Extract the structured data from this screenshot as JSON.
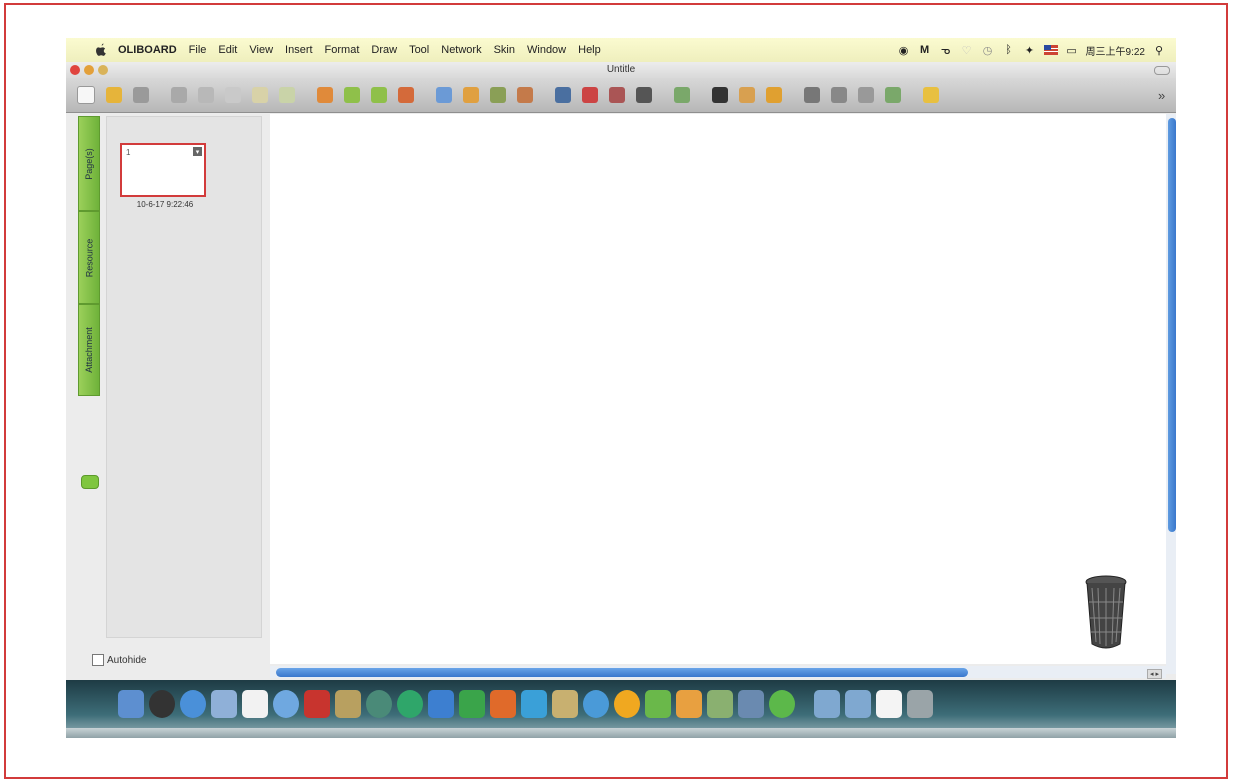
{
  "menubar": {
    "brand": "OLIBOARD",
    "items": [
      "File",
      "Edit",
      "View",
      "Insert",
      "Format",
      "Draw",
      "Tool",
      "Network",
      "Skin",
      "Window",
      "Help"
    ],
    "clock": "周三上午9:22"
  },
  "window": {
    "title": "Untitle"
  },
  "sidebar": {
    "tabs": [
      "Page(s)",
      "Resource",
      "Attachment"
    ],
    "page_number": "1",
    "page_date": "10-6-17 9:22:46",
    "autohide_label": "Autohide"
  },
  "colors": {
    "frame_border": "#d23b3b",
    "menubar_bg": "#f4f4c8",
    "sidebar_tab": "#7fc63f",
    "scrollbar": "#3a78cc"
  },
  "icons": {
    "toolbar": [
      "new-icon",
      "open-icon",
      "save-icon",
      "copy-icon",
      "paste-icon",
      "cut-icon",
      "undo-icon",
      "redo-icon",
      "import-icon",
      "back-icon",
      "forward-icon",
      "export-icon",
      "zoom-icon",
      "play-icon",
      "capture-icon",
      "record-icon",
      "select-icon",
      "pen-icon",
      "marker-icon",
      "brush-icon",
      "highlighter-icon",
      "line-icon",
      "shape-icon",
      "fill-icon",
      "line-width-icon",
      "line-style-icon",
      "color-icon",
      "eraser-icon",
      "hand-icon"
    ],
    "dock": [
      "finder-icon",
      "dashboard-icon",
      "safari-icon",
      "preview-icon",
      "calendar-icon",
      "itunes-icon",
      "photo-icon",
      "star-icon",
      "time-machine-icon",
      "app-icon",
      "word-icon",
      "excel-icon",
      "powerpoint-icon",
      "c-icon",
      "chart-icon",
      "globe-icon",
      "o-icon",
      "user-icon",
      "folder-icon",
      "mail-icon",
      "photos-icon",
      "leaf-icon",
      "folder-a-icon",
      "folder-b-icon",
      "document-icon",
      "trash-dock-icon"
    ]
  }
}
